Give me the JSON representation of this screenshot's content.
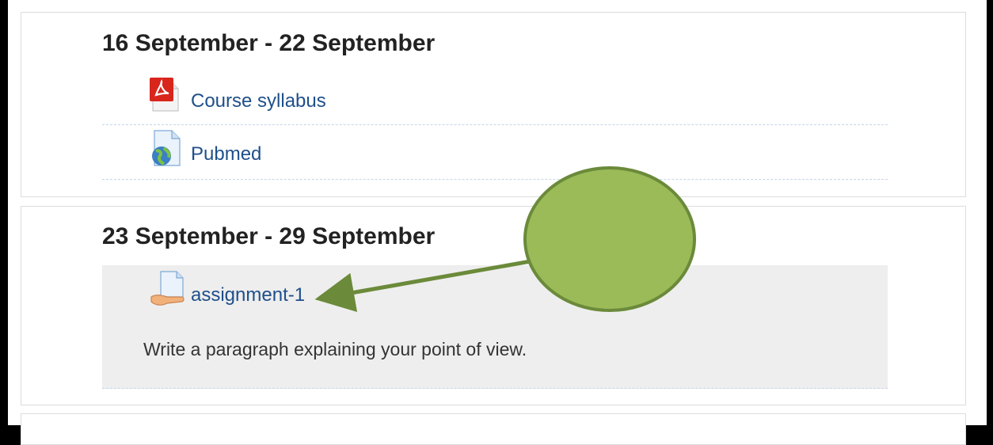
{
  "sections": [
    {
      "title": "16 September - 22 September",
      "activities": [
        {
          "label": "Course syllabus",
          "icon": "pdf-icon"
        },
        {
          "label": "Pubmed",
          "icon": "url-globe-icon"
        }
      ]
    },
    {
      "title": "23 September - 29 September",
      "activities": [
        {
          "label": "assignment-1",
          "icon": "assignment-icon",
          "description": "Write a paragraph explaining your point of view."
        }
      ]
    }
  ],
  "annotation": {
    "shape": "ellipse-with-arrow",
    "color": "#9bbb59",
    "stroke": "#6b8a3a"
  }
}
